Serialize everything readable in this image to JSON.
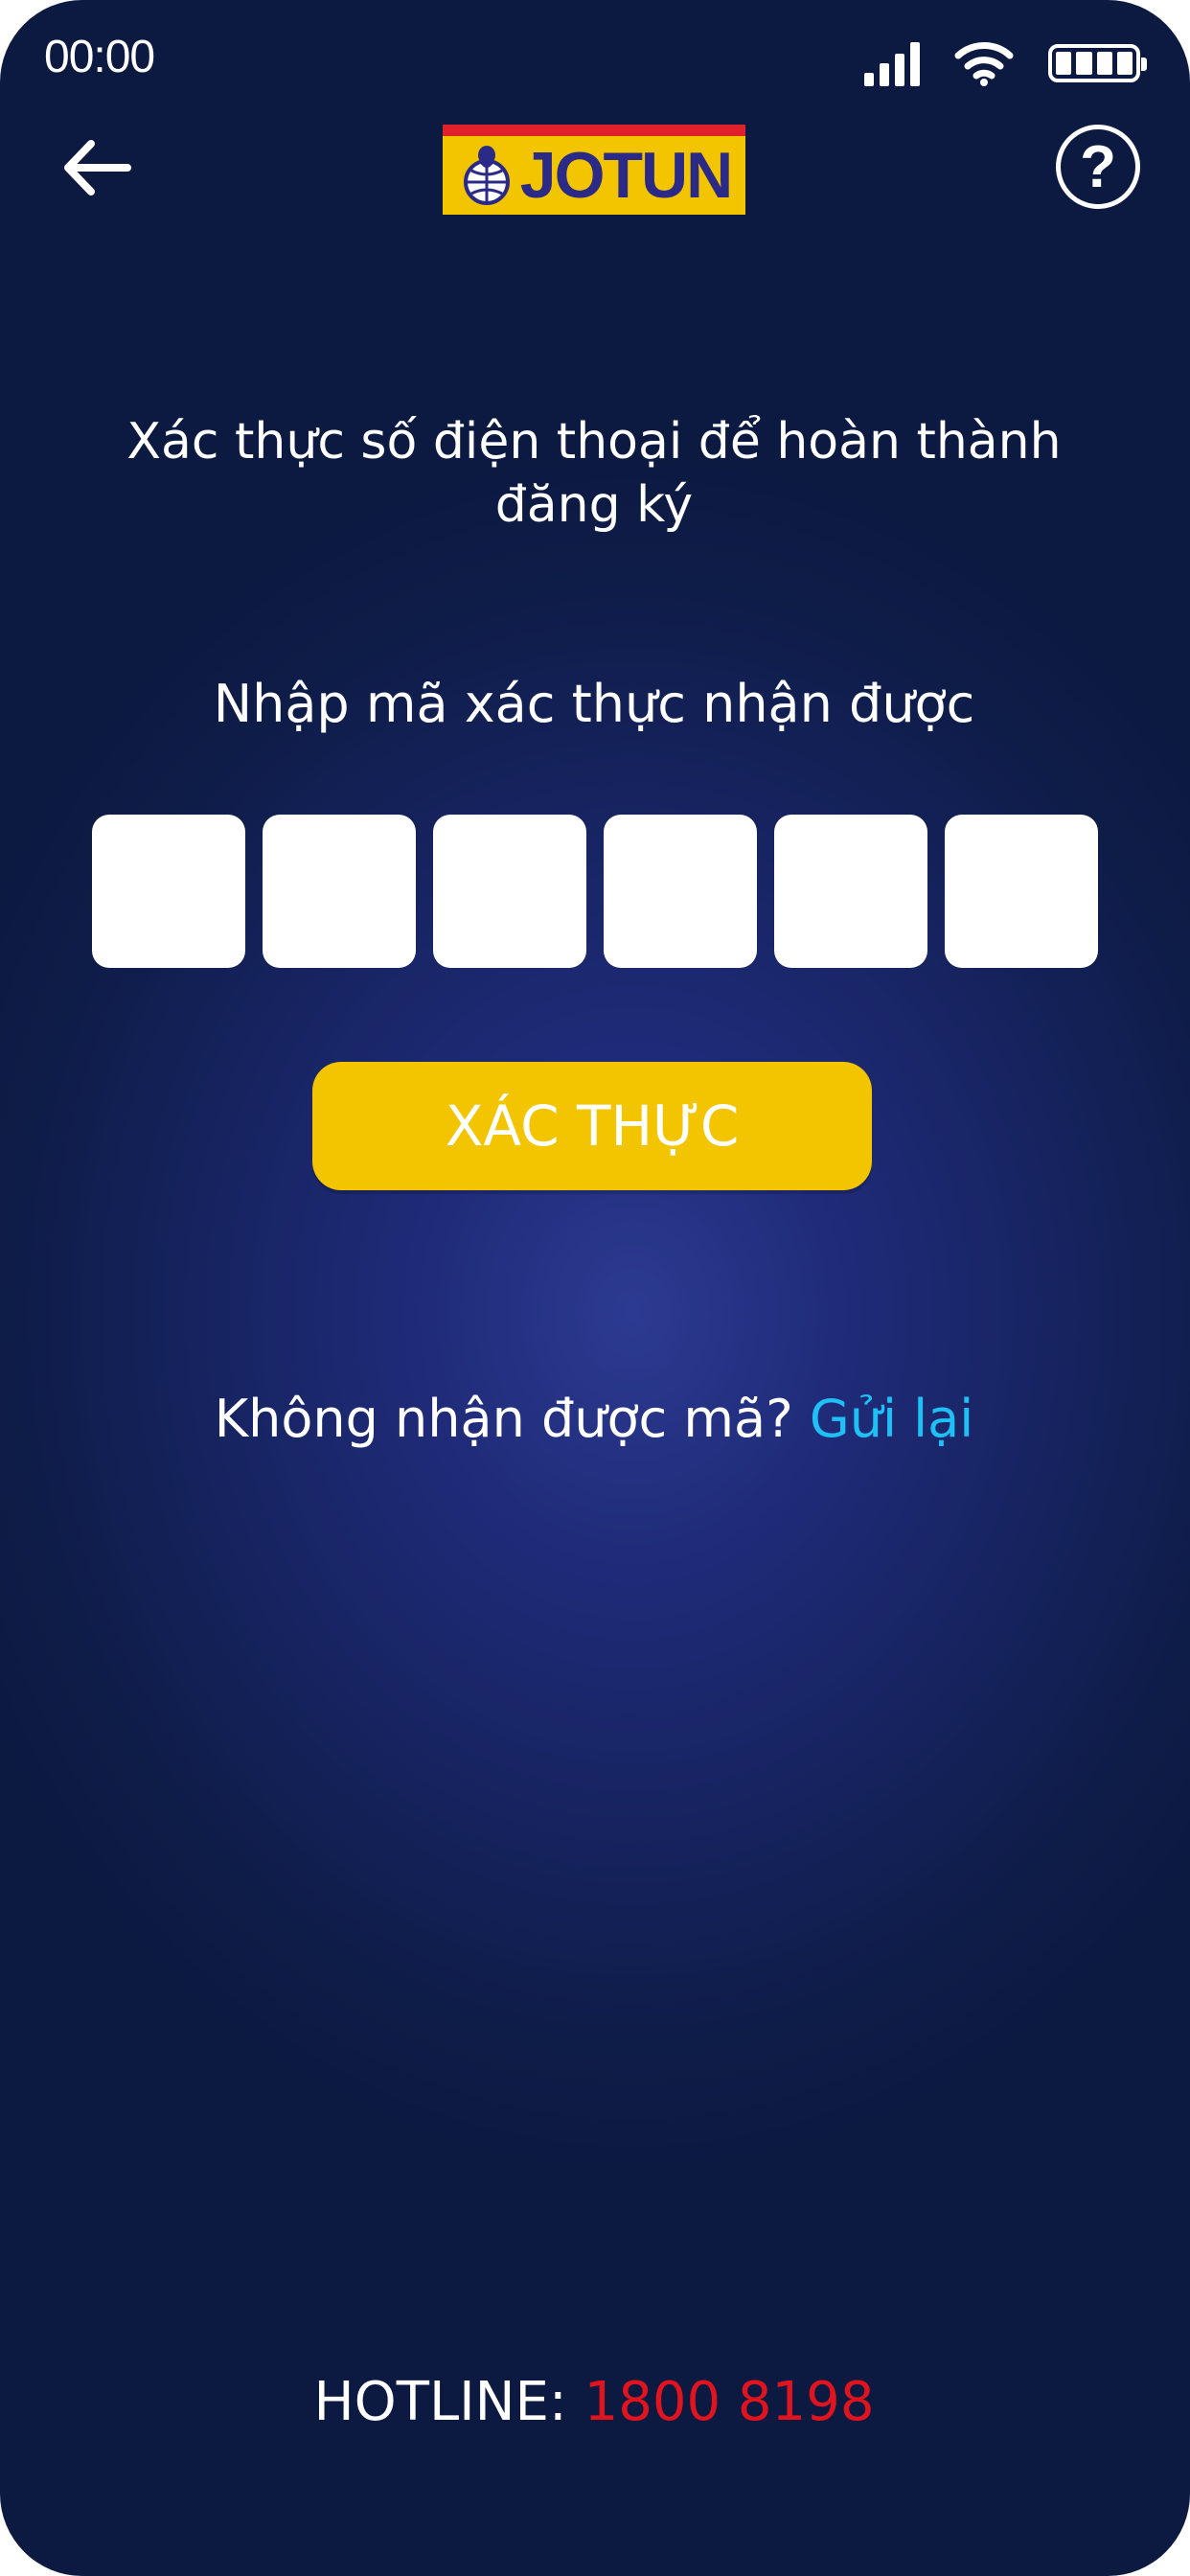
{
  "status_bar": {
    "time": "00:00",
    "icons": [
      "signal-icon",
      "wifi-icon",
      "battery-icon"
    ]
  },
  "header": {
    "back_icon": "arrow-left-icon",
    "logo_text": "JOTUN",
    "help_icon": "question-mark-icon",
    "help_glyph": "?"
  },
  "main": {
    "title": "Xác thực số điện thoại để hoàn thành đăng ký",
    "instruction": "Nhập mã xác thực nhận được",
    "otp_digits": [
      "",
      "",
      "",
      "",
      "",
      ""
    ],
    "verify_label": "XÁC THỰC",
    "resend_prompt": "Không nhận được mã?",
    "resend_link": "Gửi lại"
  },
  "footer": {
    "hotline_label": "HOTLINE:",
    "hotline_number": "1800 8198"
  },
  "colors": {
    "background": "#16235f",
    "accent_yellow": "#f2c500",
    "link_cyan": "#1fc0f5",
    "hotline_red": "#e0141e",
    "logo_blue": "#2b2a86",
    "logo_red": "#e0202a"
  }
}
